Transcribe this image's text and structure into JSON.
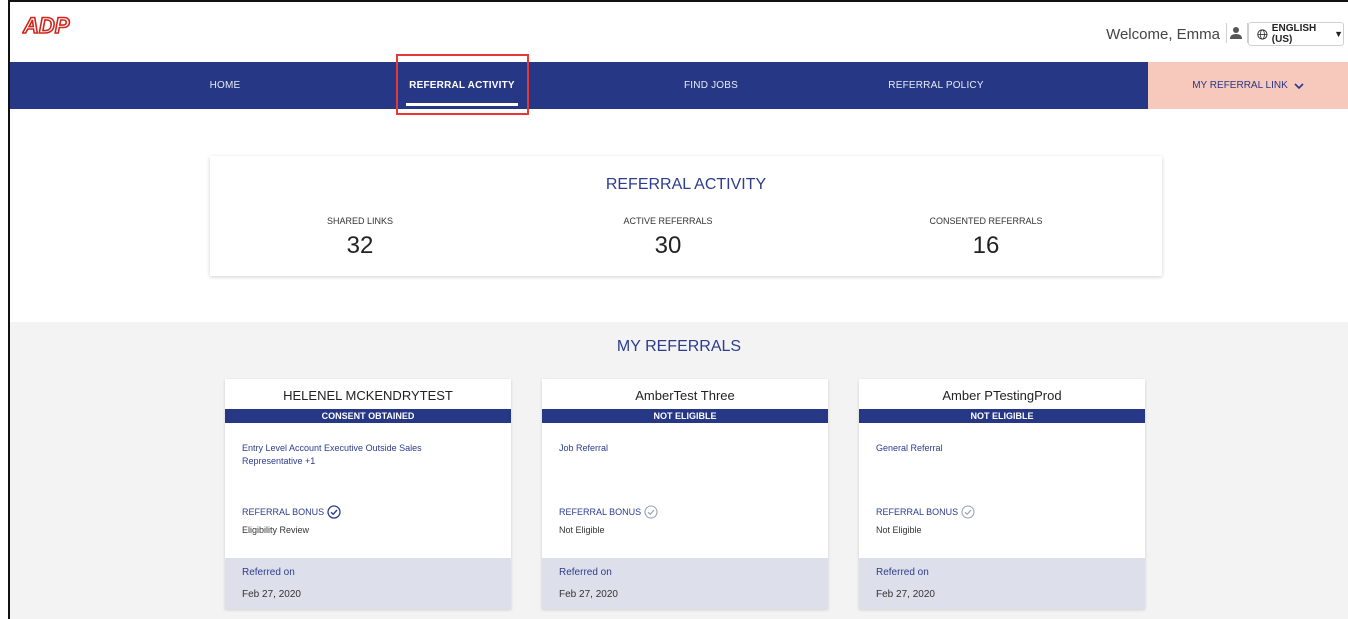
{
  "header": {
    "logo_text": "ADP",
    "welcome": "Welcome, Emma",
    "language": "ENGLISH (US)"
  },
  "nav": {
    "items": [
      {
        "label": "HOME"
      },
      {
        "label": "REFERRAL ACTIVITY",
        "active": true
      },
      {
        "label": "FIND JOBS"
      },
      {
        "label": "REFERRAL POLICY"
      }
    ],
    "cta_label": "MY REFERRAL LINK"
  },
  "activity": {
    "title": "REFERRAL ACTIVITY",
    "stats": [
      {
        "label": "SHARED LINKS",
        "value": "32"
      },
      {
        "label": "ACTIVE REFERRALS",
        "value": "30"
      },
      {
        "label": "CONSENTED REFERRALS",
        "value": "16"
      }
    ]
  },
  "referrals": {
    "title": "MY REFERRALS",
    "cards": [
      {
        "name": "HELENEL MCKENDRYTEST",
        "status": "CONSENT OBTAINED",
        "job": "Entry Level Account Executive Outside Sales Representative +1",
        "bonus_label": "REFERRAL BONUS",
        "bonus_status": "Eligibility Review",
        "referred_label": "Referred on",
        "referred_date": "Feb 27, 2020"
      },
      {
        "name": "AmberTest Three",
        "status": "NOT ELIGIBLE",
        "job": "Job Referral",
        "bonus_label": "REFERRAL BONUS",
        "bonus_status": "Not Eligible",
        "referred_label": "Referred on",
        "referred_date": "Feb 27, 2020"
      },
      {
        "name": "Amber PTestingProd",
        "status": "NOT ELIGIBLE",
        "job": "General Referral",
        "bonus_label": "REFERRAL BONUS",
        "bonus_status": "Not Eligible",
        "referred_label": "Referred on",
        "referred_date": "Feb 27, 2020"
      }
    ]
  },
  "colors": {
    "brand_red": "#d0271d",
    "nav_blue": "#263785",
    "cta_peach": "#f7c9bd",
    "highlight_red": "#e53935"
  }
}
